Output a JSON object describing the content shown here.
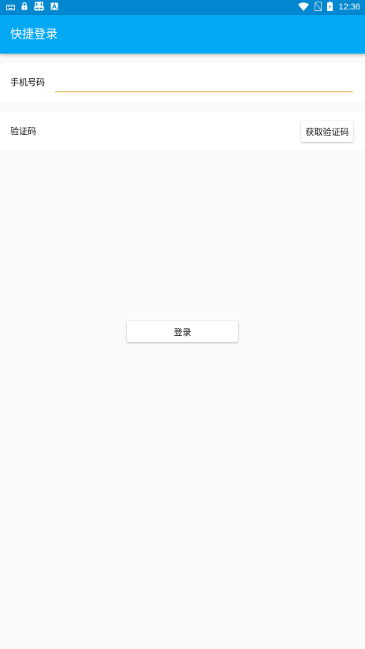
{
  "status_bar": {
    "time": "12:36",
    "left_icons": [
      "keyboard-icon",
      "lock-icon",
      "debug-icon",
      "font-icon"
    ],
    "right_icons": [
      "wifi-icon",
      "no-sim-icon",
      "battery-icon"
    ]
  },
  "app_bar": {
    "title": "快捷登录"
  },
  "form": {
    "phone_label": "手机号码",
    "phone_value": "",
    "code_label": "验证码",
    "get_code_label": "获取验证码"
  },
  "login_button": {
    "label": "登录"
  },
  "colors": {
    "status_bar": "#0288d1",
    "app_bar": "#03a9f4",
    "input_underline": "#e0a423",
    "background": "#fafafa"
  }
}
